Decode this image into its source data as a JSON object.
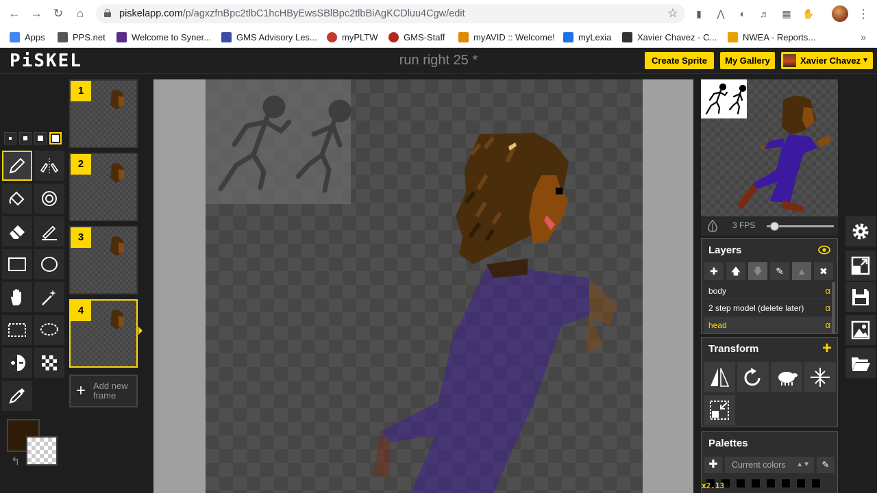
{
  "browser": {
    "url_domain": "piskelapp.com",
    "url_path": "/p/agxzfnBpc2tlbC1hcHByEwsSBlBpc2tlbBiAgKCDluu4Cgw/edit",
    "bookmarks": [
      {
        "label": "Apps",
        "color": "#4285f4"
      },
      {
        "label": "PPS.net",
        "color": "#555555"
      },
      {
        "label": "Welcome to Syner...",
        "color": "#5b2d8a"
      },
      {
        "label": "GMS Advisory Les...",
        "color": "#3c4ba8"
      },
      {
        "label": "myPLTW",
        "color": "#c0392b"
      },
      {
        "label": "GMS-Staff",
        "color": "#b3261e"
      },
      {
        "label": "myAVID :: Welcome!",
        "color": "#e08a00"
      },
      {
        "label": "myLexia",
        "color": "#1a73e8"
      },
      {
        "label": "Xavier Chavez - C...",
        "color": "#333333"
      },
      {
        "label": "NWEA - Reports...",
        "color": "#e8a000"
      }
    ],
    "more": "»"
  },
  "app": {
    "logo": "PiSKEL",
    "title": "run right 25 *",
    "create_sprite": "Create Sprite",
    "my_gallery": "My Gallery",
    "user_name": "Xavier Chavez"
  },
  "frames": [
    {
      "num": "1"
    },
    {
      "num": "2"
    },
    {
      "num": "3"
    },
    {
      "num": "4"
    }
  ],
  "add_frame_label": "Add new frame",
  "preview": {
    "fps_label": "3 FPS",
    "fps_fraction": 0.06
  },
  "layers": {
    "title": "Layers",
    "items": [
      {
        "name": "body",
        "alpha": "α"
      },
      {
        "name": "2 step model (delete later)",
        "alpha": "α"
      },
      {
        "name": "head",
        "alpha": "α"
      }
    ],
    "selected_index": 2
  },
  "transform": {
    "title": "Transform"
  },
  "palettes": {
    "title": "Palettes",
    "selected": "Current colors"
  },
  "zoom_label": "x2.13",
  "colors": {
    "accent": "#ffd700",
    "primary_color": "#2e1d06",
    "hair": "#4a2e0c",
    "skin": "#8a4a0c",
    "suit": "#3c1aa0",
    "shoe": "#7a2a12"
  }
}
